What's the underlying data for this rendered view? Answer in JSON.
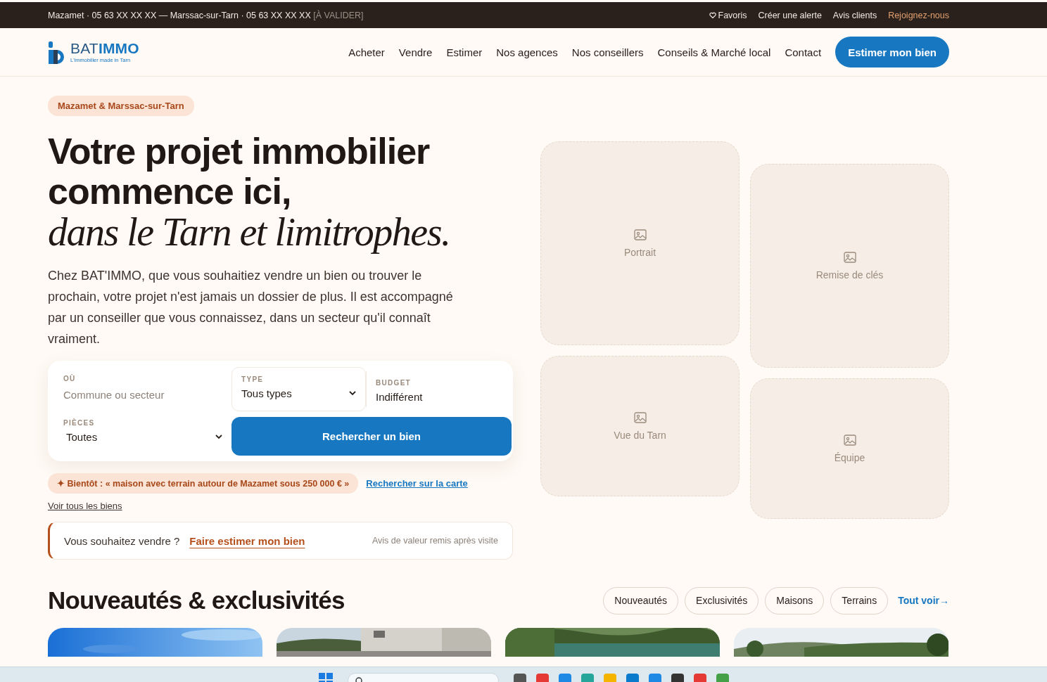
{
  "top_bar": {
    "contact": "Mazamet · 05 63 XX XX XX — Marssac-sur-Tarn · 05 63 XX XX XX",
    "pending_tag": "[À VALIDER]",
    "links": [
      {
        "label": "Favoris",
        "kind": "favorite"
      },
      {
        "label": "Créer une alerte",
        "kind": "plain"
      },
      {
        "label": "Avis clients",
        "kind": "plain"
      },
      {
        "label": "Rejoignez-nous",
        "kind": "accent"
      }
    ]
  },
  "header": {
    "logo": {
      "brand_light": "BAT",
      "brand_bold": "IMMO",
      "tagline": "L'immobilier made in Tarn"
    },
    "nav": [
      "Acheter",
      "Vendre",
      "Estimer",
      "Nos agences",
      "Nos conseillers",
      "Conseils & Marché local",
      "Contact"
    ],
    "cta": "Estimer mon bien"
  },
  "hero": {
    "badge": "Mazamet & Marssac-sur-Tarn",
    "title_line_1": "Votre projet immobilier",
    "title_line_2": "commence ici,",
    "title_italic": "dans le Tarn et limitrophes.",
    "intro": "Chez BAT'IMMO, que vous souhaitiez vendre un bien ou trouver le prochain, votre projet n'est jamais un dossier de plus. Il est accompagné par un conseiller que vous connaissez, dans un secteur qu'il connaît vraiment.",
    "search": {
      "fields": [
        {
          "kind": "text",
          "label": "OÙ",
          "placeholder": "Commune ou secteur"
        },
        {
          "kind": "select",
          "label": "TYPE",
          "value": "Tous types"
        },
        {
          "kind": "value",
          "label": "BUDGET",
          "value": "Indifférent"
        },
        {
          "kind": "select",
          "label": "PIÈCES",
          "value": "Toutes"
        }
      ],
      "button": "Rechercher un bien"
    },
    "hint": "✦ Bientôt : « maison avec terrain autour de Mazamet sous 250 000 € »",
    "map_link": "Rechercher sur la carte",
    "all_link": "Voir tous les biens",
    "sell_banner": {
      "question": "Vous souhaitez vendre ?",
      "link": "Faire estimer mon bien",
      "note": "Avis de valeur remis après visite"
    }
  },
  "media_placeholders": [
    {
      "label": "Portrait"
    },
    {
      "label": "Remise de clés"
    },
    {
      "label": "Vue du Tarn"
    },
    {
      "label": "Équipe"
    }
  ],
  "listings": {
    "title": "Nouveautés & exclusivités",
    "filters": [
      "Nouveautés",
      "Exclusivités",
      "Maisons",
      "Terrains"
    ],
    "see_all": "Tout voir→"
  }
}
